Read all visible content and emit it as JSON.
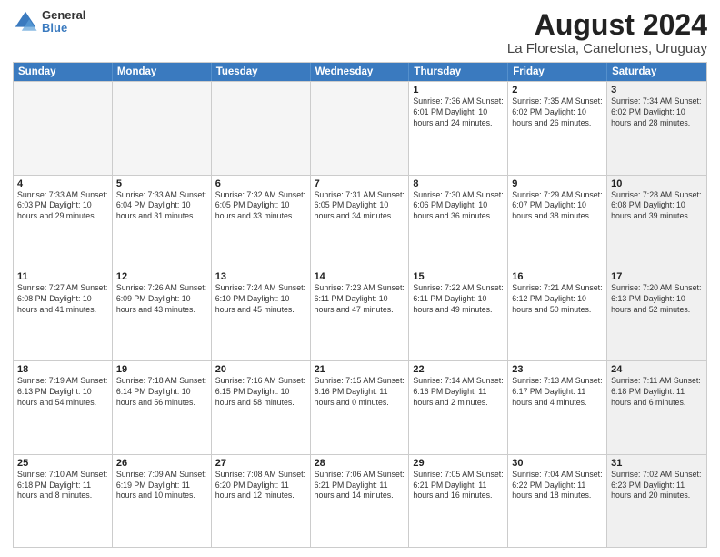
{
  "header": {
    "logo": {
      "general": "General",
      "blue": "Blue"
    },
    "title": "August 2024",
    "subtitle": "La Floresta, Canelones, Uruguay"
  },
  "calendar": {
    "days_of_week": [
      "Sunday",
      "Monday",
      "Tuesday",
      "Wednesday",
      "Thursday",
      "Friday",
      "Saturday"
    ],
    "weeks": [
      [
        {
          "day": "",
          "info": "",
          "empty": true
        },
        {
          "day": "",
          "info": "",
          "empty": true
        },
        {
          "day": "",
          "info": "",
          "empty": true
        },
        {
          "day": "",
          "info": "",
          "empty": true
        },
        {
          "day": "1",
          "info": "Sunrise: 7:36 AM\nSunset: 6:01 PM\nDaylight: 10 hours\nand 24 minutes."
        },
        {
          "day": "2",
          "info": "Sunrise: 7:35 AM\nSunset: 6:02 PM\nDaylight: 10 hours\nand 26 minutes."
        },
        {
          "day": "3",
          "info": "Sunrise: 7:34 AM\nSunset: 6:02 PM\nDaylight: 10 hours\nand 28 minutes.",
          "shaded": true
        }
      ],
      [
        {
          "day": "4",
          "info": "Sunrise: 7:33 AM\nSunset: 6:03 PM\nDaylight: 10 hours\nand 29 minutes."
        },
        {
          "day": "5",
          "info": "Sunrise: 7:33 AM\nSunset: 6:04 PM\nDaylight: 10 hours\nand 31 minutes."
        },
        {
          "day": "6",
          "info": "Sunrise: 7:32 AM\nSunset: 6:05 PM\nDaylight: 10 hours\nand 33 minutes."
        },
        {
          "day": "7",
          "info": "Sunrise: 7:31 AM\nSunset: 6:05 PM\nDaylight: 10 hours\nand 34 minutes."
        },
        {
          "day": "8",
          "info": "Sunrise: 7:30 AM\nSunset: 6:06 PM\nDaylight: 10 hours\nand 36 minutes."
        },
        {
          "day": "9",
          "info": "Sunrise: 7:29 AM\nSunset: 6:07 PM\nDaylight: 10 hours\nand 38 minutes."
        },
        {
          "day": "10",
          "info": "Sunrise: 7:28 AM\nSunset: 6:08 PM\nDaylight: 10 hours\nand 39 minutes.",
          "shaded": true
        }
      ],
      [
        {
          "day": "11",
          "info": "Sunrise: 7:27 AM\nSunset: 6:08 PM\nDaylight: 10 hours\nand 41 minutes."
        },
        {
          "day": "12",
          "info": "Sunrise: 7:26 AM\nSunset: 6:09 PM\nDaylight: 10 hours\nand 43 minutes."
        },
        {
          "day": "13",
          "info": "Sunrise: 7:24 AM\nSunset: 6:10 PM\nDaylight: 10 hours\nand 45 minutes."
        },
        {
          "day": "14",
          "info": "Sunrise: 7:23 AM\nSunset: 6:11 PM\nDaylight: 10 hours\nand 47 minutes."
        },
        {
          "day": "15",
          "info": "Sunrise: 7:22 AM\nSunset: 6:11 PM\nDaylight: 10 hours\nand 49 minutes."
        },
        {
          "day": "16",
          "info": "Sunrise: 7:21 AM\nSunset: 6:12 PM\nDaylight: 10 hours\nand 50 minutes."
        },
        {
          "day": "17",
          "info": "Sunrise: 7:20 AM\nSunset: 6:13 PM\nDaylight: 10 hours\nand 52 minutes.",
          "shaded": true
        }
      ],
      [
        {
          "day": "18",
          "info": "Sunrise: 7:19 AM\nSunset: 6:13 PM\nDaylight: 10 hours\nand 54 minutes."
        },
        {
          "day": "19",
          "info": "Sunrise: 7:18 AM\nSunset: 6:14 PM\nDaylight: 10 hours\nand 56 minutes."
        },
        {
          "day": "20",
          "info": "Sunrise: 7:16 AM\nSunset: 6:15 PM\nDaylight: 10 hours\nand 58 minutes."
        },
        {
          "day": "21",
          "info": "Sunrise: 7:15 AM\nSunset: 6:16 PM\nDaylight: 11 hours\nand 0 minutes."
        },
        {
          "day": "22",
          "info": "Sunrise: 7:14 AM\nSunset: 6:16 PM\nDaylight: 11 hours\nand 2 minutes."
        },
        {
          "day": "23",
          "info": "Sunrise: 7:13 AM\nSunset: 6:17 PM\nDaylight: 11 hours\nand 4 minutes."
        },
        {
          "day": "24",
          "info": "Sunrise: 7:11 AM\nSunset: 6:18 PM\nDaylight: 11 hours\nand 6 minutes.",
          "shaded": true
        }
      ],
      [
        {
          "day": "25",
          "info": "Sunrise: 7:10 AM\nSunset: 6:18 PM\nDaylight: 11 hours\nand 8 minutes."
        },
        {
          "day": "26",
          "info": "Sunrise: 7:09 AM\nSunset: 6:19 PM\nDaylight: 11 hours\nand 10 minutes."
        },
        {
          "day": "27",
          "info": "Sunrise: 7:08 AM\nSunset: 6:20 PM\nDaylight: 11 hours\nand 12 minutes."
        },
        {
          "day": "28",
          "info": "Sunrise: 7:06 AM\nSunset: 6:21 PM\nDaylight: 11 hours\nand 14 minutes."
        },
        {
          "day": "29",
          "info": "Sunrise: 7:05 AM\nSunset: 6:21 PM\nDaylight: 11 hours\nand 16 minutes."
        },
        {
          "day": "30",
          "info": "Sunrise: 7:04 AM\nSunset: 6:22 PM\nDaylight: 11 hours\nand 18 minutes."
        },
        {
          "day": "31",
          "info": "Sunrise: 7:02 AM\nSunset: 6:23 PM\nDaylight: 11 hours\nand 20 minutes.",
          "shaded": true
        }
      ]
    ]
  }
}
